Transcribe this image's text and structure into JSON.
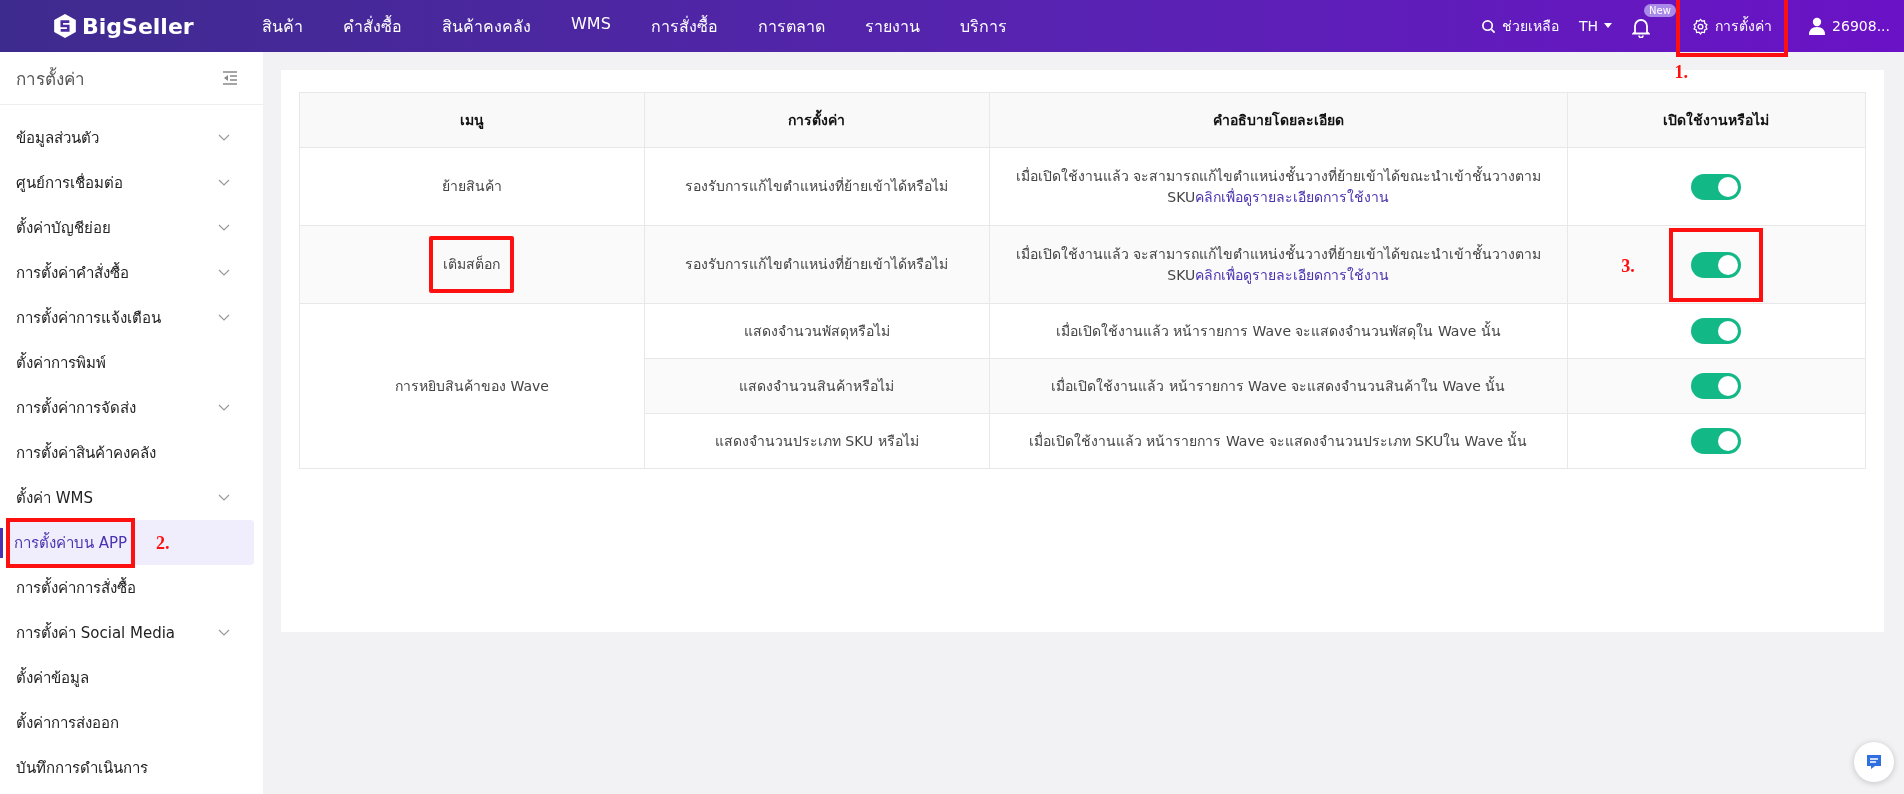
{
  "header": {
    "logo": "BigSeller",
    "nav": [
      "สินค้า",
      "คำสั่งซื้อ",
      "สินค้าคงคลัง",
      "WMS",
      "การสั่งซื้อ",
      "การตลาด",
      "รายงาน",
      "บริการ"
    ],
    "help": "ช่วยเหลือ",
    "language": "TH",
    "notification_badge": "New",
    "settings": {
      "label": "การตั้งค่า",
      "annotation": "1."
    },
    "user": "26908..."
  },
  "sidebar": {
    "title": "การตั้งค่า",
    "items": [
      {
        "label": "ข้อมูลส่วนตัว",
        "expandable": true,
        "selected": false
      },
      {
        "label": "ศูนย์การเชื่อมต่อ",
        "expandable": true,
        "selected": false
      },
      {
        "label": "ตั้งค่าบัญชีย่อย",
        "expandable": true,
        "selected": false
      },
      {
        "label": "การตั้งค่าคำสั่งซื้อ",
        "expandable": true,
        "selected": false
      },
      {
        "label": "การตั้งค่าการแจ้งเตือน",
        "expandable": true,
        "selected": false
      },
      {
        "label": "ตั้งค่าการพิมพ์",
        "expandable": false,
        "selected": false
      },
      {
        "label": "การตั้งค่าการจัดส่ง",
        "expandable": true,
        "selected": false
      },
      {
        "label": "การตั้งค่าสินค้าคงคลัง",
        "expandable": false,
        "selected": false
      },
      {
        "label": "ตั้งค่า WMS",
        "expandable": true,
        "selected": false
      },
      {
        "label": "การตั้งค่าบน APP",
        "expandable": false,
        "selected": true,
        "annotation": "2."
      },
      {
        "label": "การตั้งค่าการสั่งซื้อ",
        "expandable": false,
        "selected": false
      },
      {
        "label": "การตั้งค่า Social Media",
        "expandable": true,
        "selected": false
      },
      {
        "label": "ตั้งค่าข้อมูล",
        "expandable": false,
        "selected": false
      },
      {
        "label": "ตั้งค่าการส่งออก",
        "expandable": false,
        "selected": false
      },
      {
        "label": "บันทึกการดำเนินการ",
        "expandable": false,
        "selected": false
      }
    ]
  },
  "table": {
    "columns": [
      "เมนู",
      "การตั้งค่า",
      "คำอธิบายโดยละเอียด",
      "เปิดใช้งานหรือไม่"
    ],
    "groups": [
      {
        "menu": "ย้ายสินค้า",
        "settings": [
          {
            "setting": "รองรับการแก้ไขตำแหน่งที่ย้ายเข้าได้หรือไม่",
            "description": "เมื่อเปิดใช้งานแล้ว จะสามารถแก้ไขตำแหน่งชั้นวางที่ย้ายเข้าได้ขณะนำเข้าชั้นวางตาม SKU",
            "link": "คลิกเพื่อดูรายละเอียดการใช้งาน",
            "on": true
          }
        ]
      },
      {
        "menu": "เติมสต็อก",
        "menu_annotation": true,
        "settings": [
          {
            "setting": "รองรับการแก้ไขตำแหน่งที่ย้ายเข้าได้หรือไม่",
            "description": "เมื่อเปิดใช้งานแล้ว จะสามารถแก้ไขตำแหน่งชั้นวางที่ย้ายเข้าได้ขณะนำเข้าชั้นวางตาม SKU",
            "link": "คลิกเพื่อดูรายละเอียดการใช้งาน",
            "on": true,
            "annotation": "3."
          }
        ]
      },
      {
        "menu": "การหยิบสินค้าของ Wave",
        "settings": [
          {
            "setting": "แสดงจำนวนพัสดุหรือไม่",
            "description": "เมื่อเปิดใช้งานแล้ว หน้ารายการ Wave จะแสดงจำนวนพัสดุใน Wave นั้น",
            "on": true
          },
          {
            "setting": "แสดงจำนวนสินค้าหรือไม่",
            "description": "เมื่อเปิดใช้งานแล้ว หน้ารายการ Wave จะแสดงจำนวนสินค้าใน Wave นั้น",
            "on": true
          },
          {
            "setting": "แสดงจำนวนประเภท SKU หรือไม่",
            "description": "เมื่อเปิดใช้งานแล้ว หน้ารายการ Wave จะแสดงจำนวนประเภท SKUใน Wave นั้น",
            "on": true
          }
        ]
      }
    ]
  }
}
